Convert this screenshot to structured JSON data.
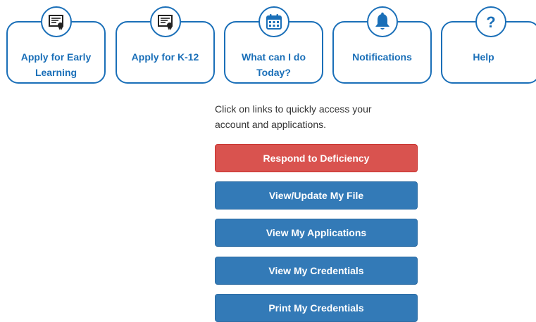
{
  "tiles": [
    {
      "label_line1": "Apply for Early",
      "label_line2": "Learning",
      "icon": "certificate-icon"
    },
    {
      "label_line1": "Apply for K-12",
      "label_line2": "",
      "icon": "certificate-icon"
    },
    {
      "label_line1": "What can I do",
      "label_line2": "Today?",
      "icon": "calendar-icon"
    },
    {
      "label_line1": "Notifications",
      "label_line2": "",
      "icon": "bell-icon"
    },
    {
      "label_line1": "Help",
      "label_line2": "",
      "icon": "question-icon"
    }
  ],
  "main": {
    "help_line1": "Click on links to quickly access your",
    "help_line2": "account and applications.",
    "buttons": [
      {
        "label": "Respond to Deficiency",
        "variant": "danger"
      },
      {
        "label": "View/Update My File",
        "variant": "primary"
      },
      {
        "label": "View My Applications",
        "variant": "primary"
      },
      {
        "label": "View My Credentials",
        "variant": "primary"
      },
      {
        "label": "Print My Credentials",
        "variant": "primary"
      }
    ]
  },
  "colors": {
    "accent": "#1a6fb8",
    "primary": "#337ab7",
    "danger": "#d9534f"
  }
}
